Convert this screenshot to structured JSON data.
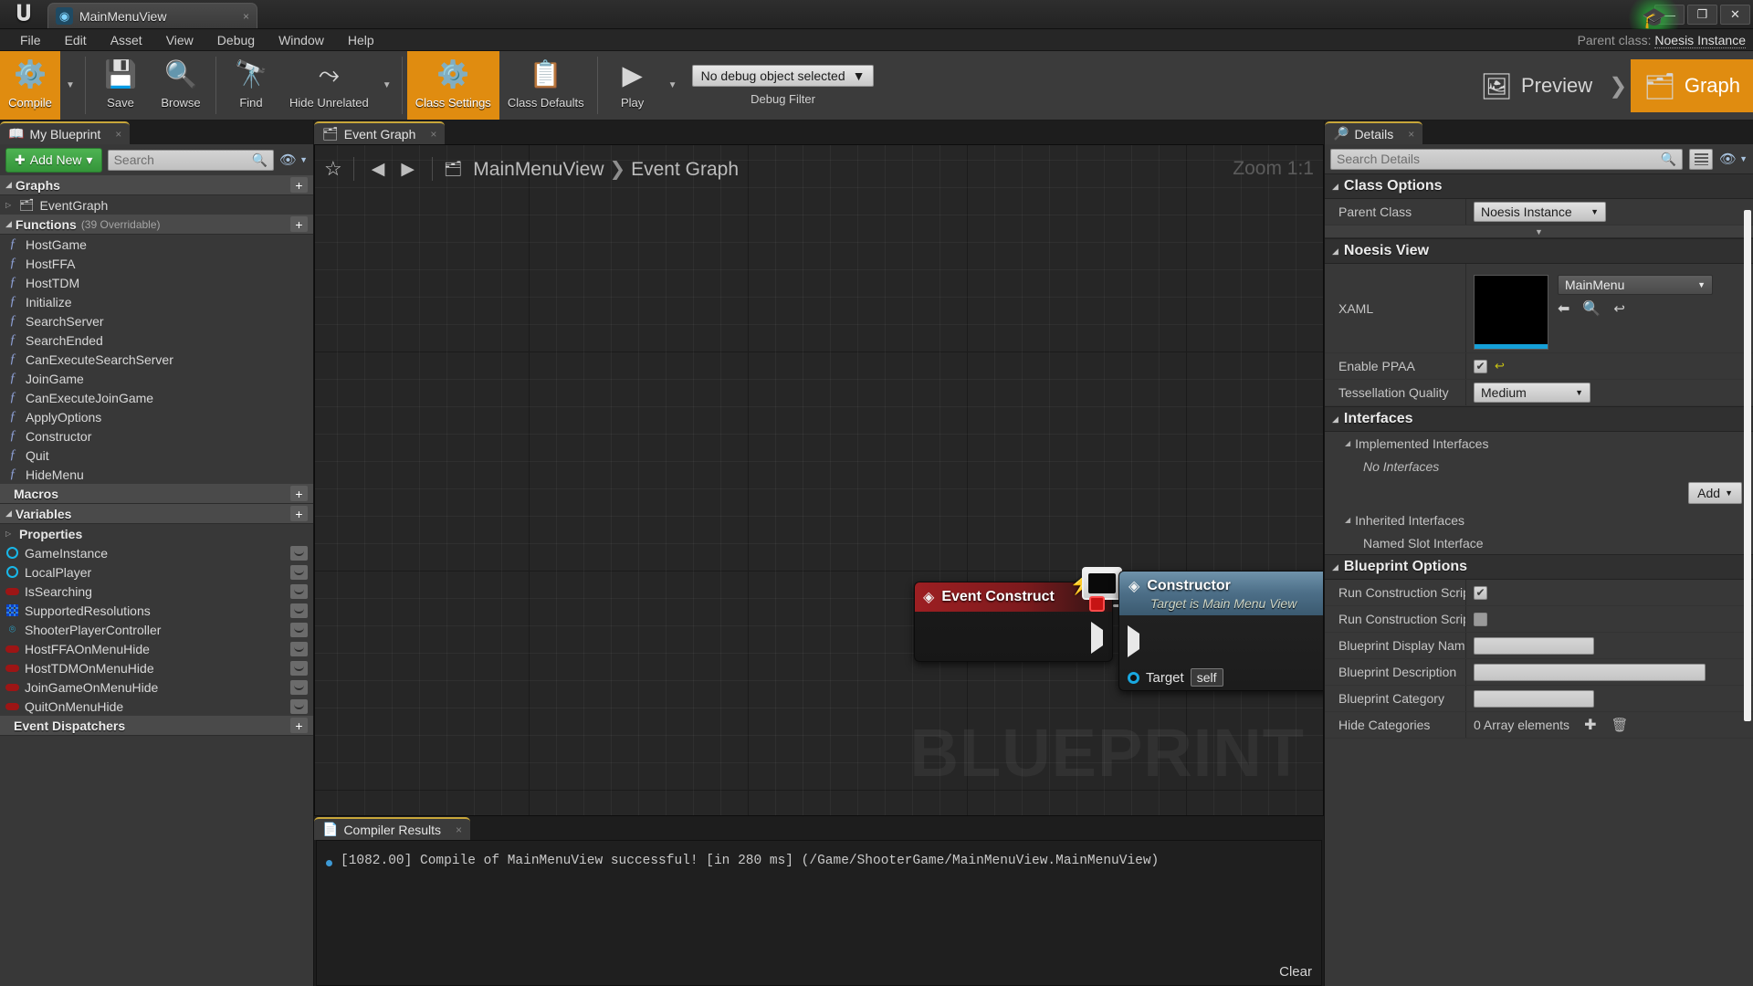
{
  "window": {
    "app_logo": "unreal-u",
    "asset_tab": "MainMenuView",
    "tab_close": "×",
    "minimize": "—",
    "maximize": "❐",
    "close": "✕",
    "parent_class_prefix": "Parent class:",
    "parent_class_value": "Noesis Instance",
    "tutorial_icon": "🎓"
  },
  "menu": [
    "File",
    "Edit",
    "Asset",
    "View",
    "Debug",
    "Window",
    "Help"
  ],
  "toolbar": {
    "compile": "Compile",
    "save": "Save",
    "browse": "Browse",
    "find": "Find",
    "hide_unrelated": "Hide Unrelated",
    "class_settings": "Class Settings",
    "class_defaults": "Class Defaults",
    "play": "Play",
    "debug_object": "No debug object selected",
    "debug_filter": "Debug Filter",
    "mode_preview": "Preview",
    "mode_graph": "Graph",
    "mode_chevron": "❯"
  },
  "my_blueprint": {
    "tab_label": "My Blueprint",
    "tab_close": "×",
    "add_new": "Add New",
    "search_placeholder": "Search",
    "graphs": {
      "title": "Graphs",
      "items": [
        "EventGraph"
      ]
    },
    "functions": {
      "title": "Functions",
      "subtitle": "(39 Overridable)",
      "items": [
        "HostGame",
        "HostFFA",
        "HostTDM",
        "Initialize",
        "SearchServer",
        "SearchEnded",
        "CanExecuteSearchServer",
        "JoinGame",
        "CanExecuteJoinGame",
        "ApplyOptions",
        "Constructor",
        "Quit",
        "HideMenu"
      ]
    },
    "macros": {
      "title": "Macros"
    },
    "variables": {
      "title": "Variables",
      "properties_label": "Properties",
      "items": [
        {
          "name": "GameInstance",
          "type": "object"
        },
        {
          "name": "LocalPlayer",
          "type": "object"
        },
        {
          "name": "IsSearching",
          "type": "bool"
        },
        {
          "name": "SupportedResolutions",
          "type": "array"
        },
        {
          "name": "ShooterPlayerController",
          "type": "class"
        },
        {
          "name": "HostFFAOnMenuHide",
          "type": "bool"
        },
        {
          "name": "HostTDMOnMenuHide",
          "type": "bool"
        },
        {
          "name": "JoinGameOnMenuHide",
          "type": "bool"
        },
        {
          "name": "QuitOnMenuHide",
          "type": "bool"
        }
      ]
    },
    "event_dispatchers": {
      "title": "Event Dispatchers"
    }
  },
  "graph": {
    "tab_label": "Event Graph",
    "tab_close": "×",
    "breadcrumb_root": "MainMenuView",
    "breadcrumb_sep": "❯",
    "breadcrumb_leaf": "Event Graph",
    "zoom_label": "Zoom 1:1",
    "watermark": "BLUEPRINT",
    "nodes": [
      {
        "title": "Event Construct",
        "subtitle": "",
        "kind": "event"
      },
      {
        "title": "Constructor",
        "subtitle": "Target is Main Menu View",
        "kind": "function",
        "pins": [
          {
            "label": "Target",
            "value": "self"
          }
        ]
      }
    ]
  },
  "compiler": {
    "tab_label": "Compiler Results",
    "tab_close": "×",
    "messages": [
      "[1082.00] Compile of MainMenuView successful! [in 280 ms] (/Game/ShooterGame/MainMenuView.MainMenuView)"
    ],
    "clear_label": "Clear"
  },
  "details": {
    "tab_label": "Details",
    "tab_close": "×",
    "search_placeholder": "Search Details",
    "sections": {
      "class_options": {
        "title": "Class Options",
        "parent_class_key": "Parent Class",
        "parent_class_value": "Noesis Instance"
      },
      "noesis_view": {
        "title": "Noesis View",
        "xaml_key": "XAML",
        "xaml_value": "MainMenu",
        "enable_ppaa_key": "Enable PPAA",
        "tessellation_key": "Tessellation Quality",
        "tessellation_value": "Medium"
      },
      "interfaces": {
        "title": "Interfaces",
        "implemented_key": "Implemented Interfaces",
        "implemented_value": "No Interfaces",
        "add_label": "Add",
        "inherited_key": "Inherited Interfaces",
        "inherited_value": "Named Slot Interface"
      },
      "blueprint_options": {
        "title": "Blueprint Options",
        "rows": [
          {
            "key": "Run Construction Script",
            "type": "checkbox",
            "checked": true
          },
          {
            "key": "Run Construction Script",
            "type": "checkbox",
            "checked": false
          },
          {
            "key": "Blueprint Display Name",
            "type": "text",
            "value": ""
          },
          {
            "key": "Blueprint Description",
            "type": "textwide",
            "value": ""
          },
          {
            "key": "Blueprint Category",
            "type": "text",
            "value": ""
          },
          {
            "key": "Hide Categories",
            "type": "array",
            "value": "0 Array elements"
          }
        ]
      }
    }
  },
  "colors": {
    "accent_orange": "#e08c10",
    "add_green": "#4eb352",
    "event_red": "#9d1f22",
    "function_blue": "#4d6f88",
    "pin_cyan": "#19a8e0"
  }
}
